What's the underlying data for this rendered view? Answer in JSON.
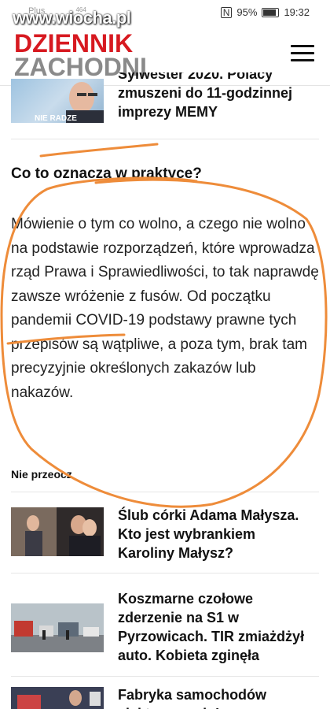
{
  "status_bar": {
    "carrier": "Plus",
    "data_rate": "464",
    "battery": "95%",
    "time": "19:32"
  },
  "watermark": "www.wiocha.pl",
  "header": {
    "logo_line1": "DZIENNIK",
    "logo_line2": "ZACHODNI"
  },
  "top_article": {
    "title_partial": "Sylwester 2020. Polacy zmuszeni do 11-godzinnej imprezy MEMY",
    "thumb_caption": "NIE RADZE"
  },
  "section": {
    "heading": "Co to oznacza w praktyce?",
    "body": "Mówienie o tym co wolno, a czego nie wolno na podstawie rozporządzeń, które wprowadza rząd Prawa i Sprawiedliwości, to tak naprawdę zawsze wróżenie z fusów. Od początku pandemii COVID-19 podstawy prawne tych przepisów są wątpliwe, a poza tym, brak tam precyzyjnie określonych zakazów lub nakazów."
  },
  "related_label": "Nie przeocz",
  "articles": [
    {
      "title": "Ślub córki Adama Małysza. Kto jest wybrankiem Karoliny Małysz?"
    },
    {
      "title": "Koszmarne czołowe zderzenie na S1 w Pyrzowicach. TIR zmiażdżył auto. Kobieta zginęła"
    },
    {
      "title": "Fabryka samochodów elektrycznych Izera powstanie"
    }
  ],
  "colors": {
    "brand_red": "#d71920",
    "brand_gray": "#8a8a8a",
    "annotation_orange": "#ee8c3a"
  }
}
